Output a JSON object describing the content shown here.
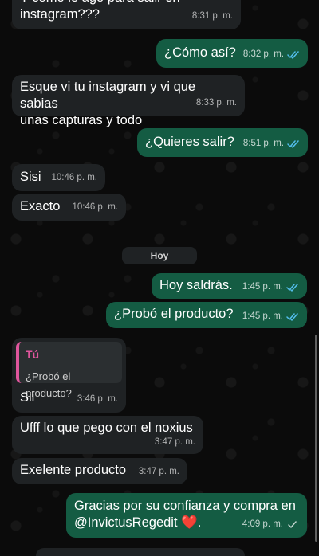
{
  "chat": {
    "messages": [
      {
        "direction": "in",
        "text_line1": "Y como le ago para salir en",
        "text_line2": "instagram???",
        "time": "8:31 p. m."
      },
      {
        "direction": "out",
        "text": "¿Cómo así?",
        "time": "8:32 p. m.",
        "status": "read"
      },
      {
        "direction": "in",
        "text_line1": "Esque vi tu instagram y vi que sabias",
        "text_line2": "unas capturas y todo",
        "time": "8:33 p. m."
      },
      {
        "direction": "out",
        "text": "¿Quieres salir?",
        "time": "8:51 p. m.",
        "status": "read"
      },
      {
        "direction": "in",
        "text": "Sisi",
        "time": "10:46 p. m."
      },
      {
        "direction": "in",
        "text": "Exacto",
        "time": "10:46 p. m."
      },
      {
        "direction": "out",
        "text": "Hoy saldrás.",
        "time": "1:45 p. m.",
        "status": "read"
      },
      {
        "direction": "out",
        "text": "¿Probó el producto?",
        "time": "1:45 p. m.",
        "status": "read"
      },
      {
        "direction": "in",
        "reply_to": {
          "author": "Tú",
          "text": "¿Probó el producto?"
        },
        "text": "Sii",
        "time": "3:46 p. m."
      },
      {
        "direction": "in",
        "text": "Ufff lo que pego con el noxius",
        "time": "3:47 p. m."
      },
      {
        "direction": "in",
        "text": "Exelente producto",
        "time": "3:47 p. m."
      },
      {
        "direction": "out",
        "text_line1": "Gracias por su confianza y compra en",
        "text_line2": "@InvictusRegedit",
        "emoji": "❤️",
        "emoji_name": "red-heart",
        "text_suffix": ".",
        "time": "4:09 p. m.",
        "status": "sent"
      }
    ],
    "date_separator": "Hoy"
  },
  "colors": {
    "incoming_bubble": "#1f2224",
    "outgoing_bubble": "#145c43",
    "read_ticks": "#53bdeb",
    "reply_accent": "#e0569d",
    "background": "#0b0b0b"
  }
}
